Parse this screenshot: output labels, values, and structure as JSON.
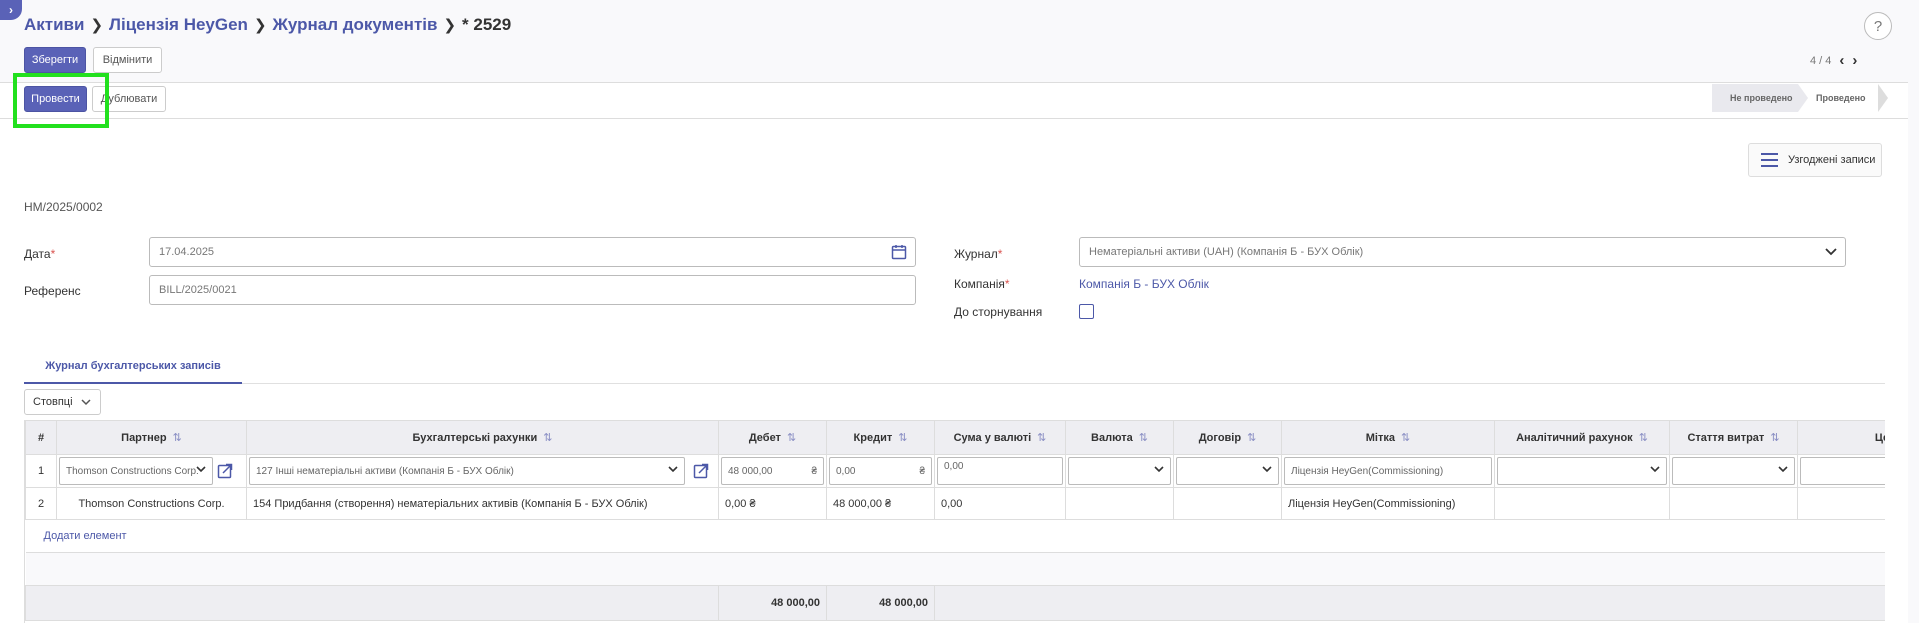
{
  "breadcrumb": {
    "items": [
      "Активи",
      "Ліцензія HeyGen",
      "Журнал документів"
    ],
    "current": "* 2529"
  },
  "help": "?",
  "toolbar": {
    "save": "Зберегти",
    "discard": "Відмінити"
  },
  "pager": {
    "value": "4 / 4"
  },
  "actions": {
    "post": "Провести",
    "duplicate": "Дублювати"
  },
  "status": {
    "stages": [
      "Не проведено",
      "Проведено"
    ],
    "active": "Не проведено"
  },
  "smart_button": {
    "label": "Узгоджені записи",
    "icon": "hamburger-icon"
  },
  "doc": {
    "name": "НМ/2025/0002"
  },
  "fields": {
    "date_label": "Дата",
    "date_value": "17.04.2025",
    "ref_label": "Референс",
    "ref_value": "BILL/2025/0021",
    "journal_label": "Журнал",
    "journal_value": "Нематеріальні активи (UAH) (Компанія Б - БУХ Облік)",
    "company_label": "Компанія",
    "company_value": "Компанія Б - БУХ Облік",
    "reversal_label": "До сторнування",
    "required_mark": "*"
  },
  "tab": {
    "label": "Журнал бухгалтерських записів"
  },
  "columns_btn": "Стовпці",
  "table": {
    "headers": [
      "#",
      "Партнер",
      "Бухгалтерські рахунки",
      "Дебет",
      "Кредит",
      "Сума у валюті",
      "Валюта",
      "Договір",
      "Мітка",
      "Аналітичний рахунок",
      "Стаття витрат",
      "Центр витрат"
    ],
    "sort_icon": "⇅",
    "rows": [
      {
        "idx": "1",
        "partner": "Thomson Constructions Corp.",
        "account": "127 Інші нематеріальні активи (Компанія Б - БУХ Облік)",
        "debit": "48 000,00",
        "debit_currency": "₴",
        "credit": "0,00",
        "credit_currency": "₴",
        "amount_currency": "0,00",
        "label": "Ліцензія HeyGen(Commissioning)"
      },
      {
        "idx": "2",
        "partner": "Thomson Constructions Corp.",
        "account": "154 Придбання (створення) нематеріальних активів (Компанія Б - БУХ Облік)",
        "debit": "0,00 ₴",
        "credit": "48 000,00 ₴",
        "amount_currency": "0,00",
        "label": "Ліцензія HeyGen(Commissioning)"
      }
    ],
    "add_line": "Додати елемент",
    "totals": {
      "debit": "48 000,00",
      "credit": "48 000,00"
    }
  },
  "colors": {
    "primary": "#5a62b7",
    "link": "#4c58a8",
    "highlight": "#22e01e",
    "required": "#d9534f"
  }
}
